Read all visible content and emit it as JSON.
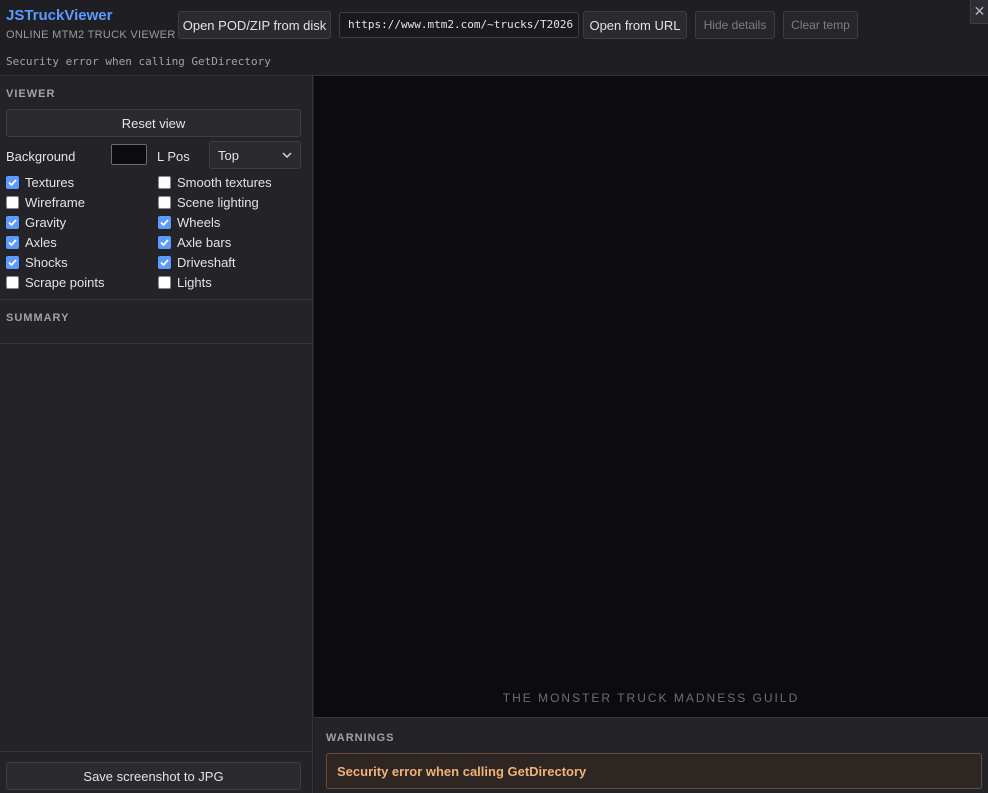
{
  "header": {
    "title": "JSTruckViewer",
    "subtitle": "ONLINE MTM2 TRUCK VIEWER",
    "status": "Security error when calling GetDirectory",
    "open_disk_label": "Open POD/ZIP from disk",
    "url_value": "https://www.mtm2.com/~trucks/T2026",
    "open_url_label": "Open from URL",
    "hide_details_label": "Hide details",
    "clear_temp_label": "Clear temp",
    "close_glyph": "✕"
  },
  "viewer": {
    "section_title": "VIEWER",
    "reset_label": "Reset view",
    "background_label": "Background",
    "background_color": "#0c0b10",
    "lpos_label": "L Pos",
    "lpos_value": "Top",
    "options": [
      {
        "label": "Textures",
        "checked": true
      },
      {
        "label": "Smooth textures",
        "checked": false
      },
      {
        "label": "Wireframe",
        "checked": false
      },
      {
        "label": "Scene lighting",
        "checked": false
      },
      {
        "label": "Gravity",
        "checked": true
      },
      {
        "label": "Wheels",
        "checked": true
      },
      {
        "label": "Axles",
        "checked": true
      },
      {
        "label": "Axle bars",
        "checked": true
      },
      {
        "label": "Shocks",
        "checked": true
      },
      {
        "label": "Driveshaft",
        "checked": true
      },
      {
        "label": "Scrape points",
        "checked": false
      },
      {
        "label": "Lights",
        "checked": false
      }
    ]
  },
  "summary": {
    "section_title": "SUMMARY"
  },
  "footer": {
    "save_label": "Save screenshot to JPG"
  },
  "viewport": {
    "watermark": "THE MONSTER TRUCK MADNESS GUILD"
  },
  "warnings": {
    "title": "WARNINGS",
    "message": "Security error when calling GetDirectory"
  },
  "colors": {
    "accent": "#5b9bff",
    "warning_text": "#f0b27a"
  }
}
